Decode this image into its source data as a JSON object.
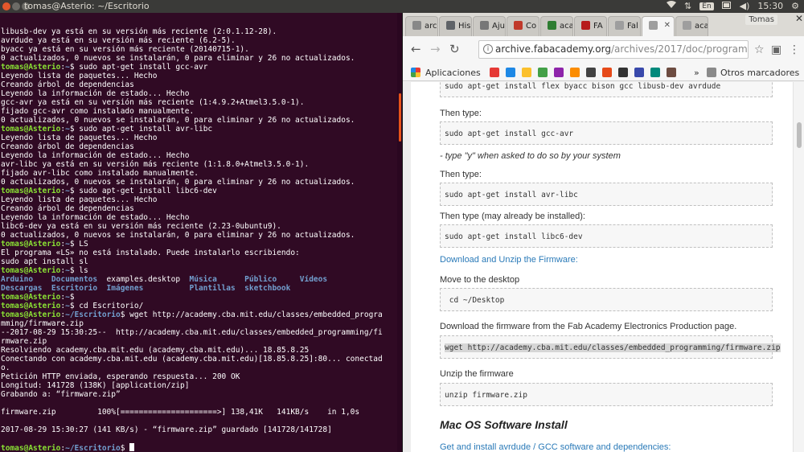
{
  "top_panel": {
    "window_title": "tomas@Asterio: ~/Escritorio",
    "keyboard": "En",
    "time": "15:30"
  },
  "terminal": {
    "lines": [
      [
        [
          "t",
          "libusb-dev ya está en su versión más reciente (2:0.1.12-28)."
        ]
      ],
      [
        [
          "t",
          "avrdude ya está en su versión más reciente (6.2-5)."
        ]
      ],
      [
        [
          "t",
          "byacc ya está en su versión más reciente (20140715-1)."
        ]
      ],
      [
        [
          "t",
          "0 actualizados, 0 nuevos se instalarán, 0 para eliminar y 26 no actualizados."
        ]
      ],
      [
        [
          "u",
          "tomas@Asterio"
        ],
        [
          "t",
          ":"
        ],
        [
          "p",
          "~"
        ],
        [
          "t",
          "$ sudo apt-get install gcc-avr"
        ]
      ],
      [
        [
          "t",
          "Leyendo lista de paquetes... Hecho"
        ]
      ],
      [
        [
          "t",
          "Creando árbol de dependencias"
        ]
      ],
      [
        [
          "t",
          "Leyendo la información de estado... Hecho"
        ]
      ],
      [
        [
          "t",
          "gcc-avr ya está en su versión más reciente (1:4.9.2+Atmel3.5.0-1)."
        ]
      ],
      [
        [
          "t",
          "fijado gcc-avr como instalado manualmente."
        ]
      ],
      [
        [
          "t",
          "0 actualizados, 0 nuevos se instalarán, 0 para eliminar y 26 no actualizados."
        ]
      ],
      [
        [
          "u",
          "tomas@Asterio"
        ],
        [
          "t",
          ":"
        ],
        [
          "p",
          "~"
        ],
        [
          "t",
          "$ sudo apt-get install avr-libc"
        ]
      ],
      [
        [
          "t",
          "Leyendo lista de paquetes... Hecho"
        ]
      ],
      [
        [
          "t",
          "Creando árbol de dependencias"
        ]
      ],
      [
        [
          "t",
          "Leyendo la información de estado... Hecho"
        ]
      ],
      [
        [
          "t",
          "avr-libc ya está en su versión más reciente (1:1.8.0+Atmel3.5.0-1)."
        ]
      ],
      [
        [
          "t",
          "fijado avr-libc como instalado manualmente."
        ]
      ],
      [
        [
          "t",
          "0 actualizados, 0 nuevos se instalarán, 0 para eliminar y 26 no actualizados."
        ]
      ],
      [
        [
          "u",
          "tomas@Asterio"
        ],
        [
          "t",
          ":"
        ],
        [
          "p",
          "~"
        ],
        [
          "t",
          "$ sudo apt-get install libc6-dev"
        ]
      ],
      [
        [
          "t",
          "Leyendo lista de paquetes... Hecho"
        ]
      ],
      [
        [
          "t",
          "Creando árbol de dependencias"
        ]
      ],
      [
        [
          "t",
          "Leyendo la información de estado... Hecho"
        ]
      ],
      [
        [
          "t",
          "libc6-dev ya está en su versión más reciente (2.23-0ubuntu9)."
        ]
      ],
      [
        [
          "t",
          "0 actualizados, 0 nuevos se instalarán, 0 para eliminar y 26 no actualizados."
        ]
      ],
      [
        [
          "u",
          "tomas@Asterio"
        ],
        [
          "t",
          ":"
        ],
        [
          "p",
          "~"
        ],
        [
          "t",
          "$ LS"
        ]
      ],
      [
        [
          "t",
          "El programa «LS» no está instalado. Puede instalarlo escribiendo:"
        ]
      ],
      [
        [
          "t",
          "sudo apt install sl"
        ]
      ],
      [
        [
          "u",
          "tomas@Asterio"
        ],
        [
          "t",
          ":"
        ],
        [
          "p",
          "~"
        ],
        [
          "t",
          "$ ls"
        ]
      ],
      [
        [
          "d",
          "Arduino    Documentos"
        ],
        [
          "t",
          "  examples.desktop  "
        ],
        [
          "d",
          "Música      Público     Vídeos"
        ]
      ],
      [
        [
          "d",
          "Descargas  Escritorio  Imágenes          Plantillas  sketchbook"
        ]
      ],
      [
        [
          "u",
          "tomas@Asterio"
        ],
        [
          "t",
          ":"
        ],
        [
          "p",
          "~"
        ],
        [
          "t",
          "$"
        ]
      ],
      [
        [
          "u",
          "tomas@Asterio"
        ],
        [
          "t",
          ":"
        ],
        [
          "p",
          "~"
        ],
        [
          "t",
          "$ cd Escritorio/"
        ]
      ],
      [
        [
          "u",
          "tomas@Asterio"
        ],
        [
          "t",
          ":"
        ],
        [
          "p",
          "~/Escritorio"
        ],
        [
          "t",
          "$ wget http://academy.cba.mit.edu/classes/embedded_progra"
        ]
      ],
      [
        [
          "t",
          "mming/firmware.zip"
        ]
      ],
      [
        [
          "t",
          "--2017-08-29 15:30:25--  http://academy.cba.mit.edu/classes/embedded_programming/fi"
        ]
      ],
      [
        [
          "t",
          "rmware.zip"
        ]
      ],
      [
        [
          "t",
          "Resolviendo academy.cba.mit.edu (academy.cba.mit.edu)... 18.85.8.25"
        ]
      ],
      [
        [
          "t",
          "Conectando con academy.cba.mit.edu (academy.cba.mit.edu)[18.85.8.25]:80... conectad"
        ]
      ],
      [
        [
          "t",
          "o."
        ]
      ],
      [
        [
          "t",
          "Petición HTTP enviada, esperando respuesta... 200 OK"
        ]
      ],
      [
        [
          "t",
          "Longitud: 141728 (138K) [application/zip]"
        ]
      ],
      [
        [
          "t",
          "Grabando a: “firmware.zip”"
        ]
      ],
      [
        [
          "t",
          ""
        ]
      ],
      [
        [
          "t",
          "firmware.zip         100%[=====================>] 138,41K   141KB/s    in 1,0s"
        ]
      ],
      [
        [
          "t",
          ""
        ]
      ],
      [
        [
          "t",
          "2017-08-29 15:30:27 (141 KB/s) - “firmware.zip” guardado [141728/141728]"
        ]
      ],
      [
        [
          "t",
          ""
        ]
      ],
      [
        [
          "u",
          "tomas@Asterio"
        ],
        [
          "t",
          ":"
        ],
        [
          "p",
          "~/Escritorio"
        ],
        [
          "t",
          "$ "
        ],
        [
          "c",
          ""
        ]
      ]
    ]
  },
  "browser": {
    "profile": "Tomas",
    "tabs": [
      {
        "label": "arc",
        "color": "#888888"
      },
      {
        "label": "His",
        "color": "#5f6368"
      },
      {
        "label": "Aju",
        "color": "#777777"
      },
      {
        "label": "Co",
        "color": "#c0392b"
      },
      {
        "label": "aca",
        "color": "#2e7d32"
      },
      {
        "label": "FA",
        "color": "#b71c1c"
      },
      {
        "label": "Fal",
        "color": "#9e9e9e"
      },
      {
        "label": "",
        "color": "#9e9e9e"
      },
      {
        "label": "aca",
        "color": "#9e9e9e"
      }
    ],
    "url_host": "archive.fabacademy.org",
    "url_path": "/archives/2017/doc/programmin...",
    "bookmarks_apps": "Aplicaciones",
    "bookmarks_other": "Otros marcadores",
    "bookmark_icon_colors": [
      "#e53935",
      "#1e88e5",
      "#fbc02d",
      "#43a047",
      "#8e24aa",
      "#fb8c00",
      "#424242",
      "#e64a19",
      "#333333",
      "#3949ab",
      "#00897b",
      "#6d4c41"
    ]
  },
  "page": {
    "code1": "sudo apt-get install flex byacc bison gcc libusb-dev avrdude",
    "then_type_1": "Then type:",
    "code2": "sudo apt-get install gcc-avr",
    "type_y": "- type \"y\" when asked to do so by your system",
    "then_type_2": "Then type:",
    "code3": "sudo apt-get install avr-libc",
    "then_type_3": "Then type (may already be installed):",
    "code4": "sudo apt-get install libc6-dev",
    "download_link": "Download and Unzip the Firmware:",
    "move_desktop": "Move to the desktop",
    "code5": " cd ~/Desktop",
    "download_text": "Download the firmware from the Fab Academy Electronics Production page.",
    "code6": "wget http://academy.cba.mit.edu/classes/embedded_programming/firmware.zip",
    "unzip_text": "Unzip the firmware",
    "code7": "unzip firmware.zip",
    "mac_heading": "Mac OS Software Install",
    "get_install_link": "Get and install avrdude / GCC software and dependencies:"
  }
}
